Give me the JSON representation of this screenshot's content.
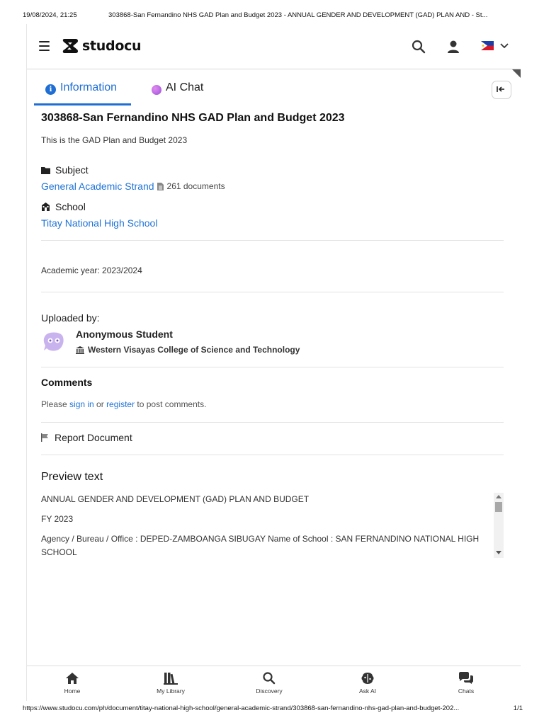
{
  "print": {
    "date": "19/08/2024, 21:25",
    "title": "303868-San Fernandino NHS GAD Plan and Budget 2023 - ANNUAL GENDER AND DEVELOPMENT (GAD) PLAN AND - St...",
    "url": "https://www.studocu.com/ph/document/titay-national-high-school/general-academic-strand/303868-san-fernandino-nhs-gad-plan-and-budget-202...",
    "page": "1/1"
  },
  "header": {
    "brand": "studocu",
    "icons": [
      "menu-icon",
      "search-icon",
      "user-icon",
      "philippines-flag-icon",
      "chevron-down-icon"
    ]
  },
  "tabs": {
    "information": "Information",
    "ai_chat": "AI Chat"
  },
  "document": {
    "title": "303868-San Fernandino NHS GAD Plan and Budget 2023",
    "description": "This is the GAD Plan and Budget 2023",
    "subject_label": "Subject",
    "subject": "General Academic Strand",
    "subject_docs": "261 documents",
    "school_label": "School",
    "school": "Titay National High School",
    "academic_year": "Academic year: 2023/2024"
  },
  "uploader": {
    "label": "Uploaded by:",
    "name": "Anonymous Student",
    "university": "Western Visayas College of Science and Technology"
  },
  "comments": {
    "heading": "Comments",
    "prefix": "Please ",
    "sign_in": "sign in",
    "middle": " or ",
    "register": "register",
    "suffix": " to post comments."
  },
  "report": "Report Document",
  "preview": {
    "heading": "Preview text",
    "paragraphs": [
      "ANNUAL GENDER AND DEVELOPMENT (GAD) PLAN AND BUDGET",
      "FY 2023",
      "Agency / Bureau / Office : DEPED-ZAMBOANGA SIBUGAY Name of School : SAN FERNANDINO NATIONAL HIGH SCHOOL"
    ]
  },
  "bottom_nav": {
    "home": "Home",
    "library": "My Library",
    "discovery": "Discovery",
    "ask_ai": "Ask AI",
    "chats": "Chats"
  },
  "colors": {
    "accent": "#1f6ed4",
    "link": "#1f73d6",
    "ai_purple": "#9a4fd9"
  }
}
